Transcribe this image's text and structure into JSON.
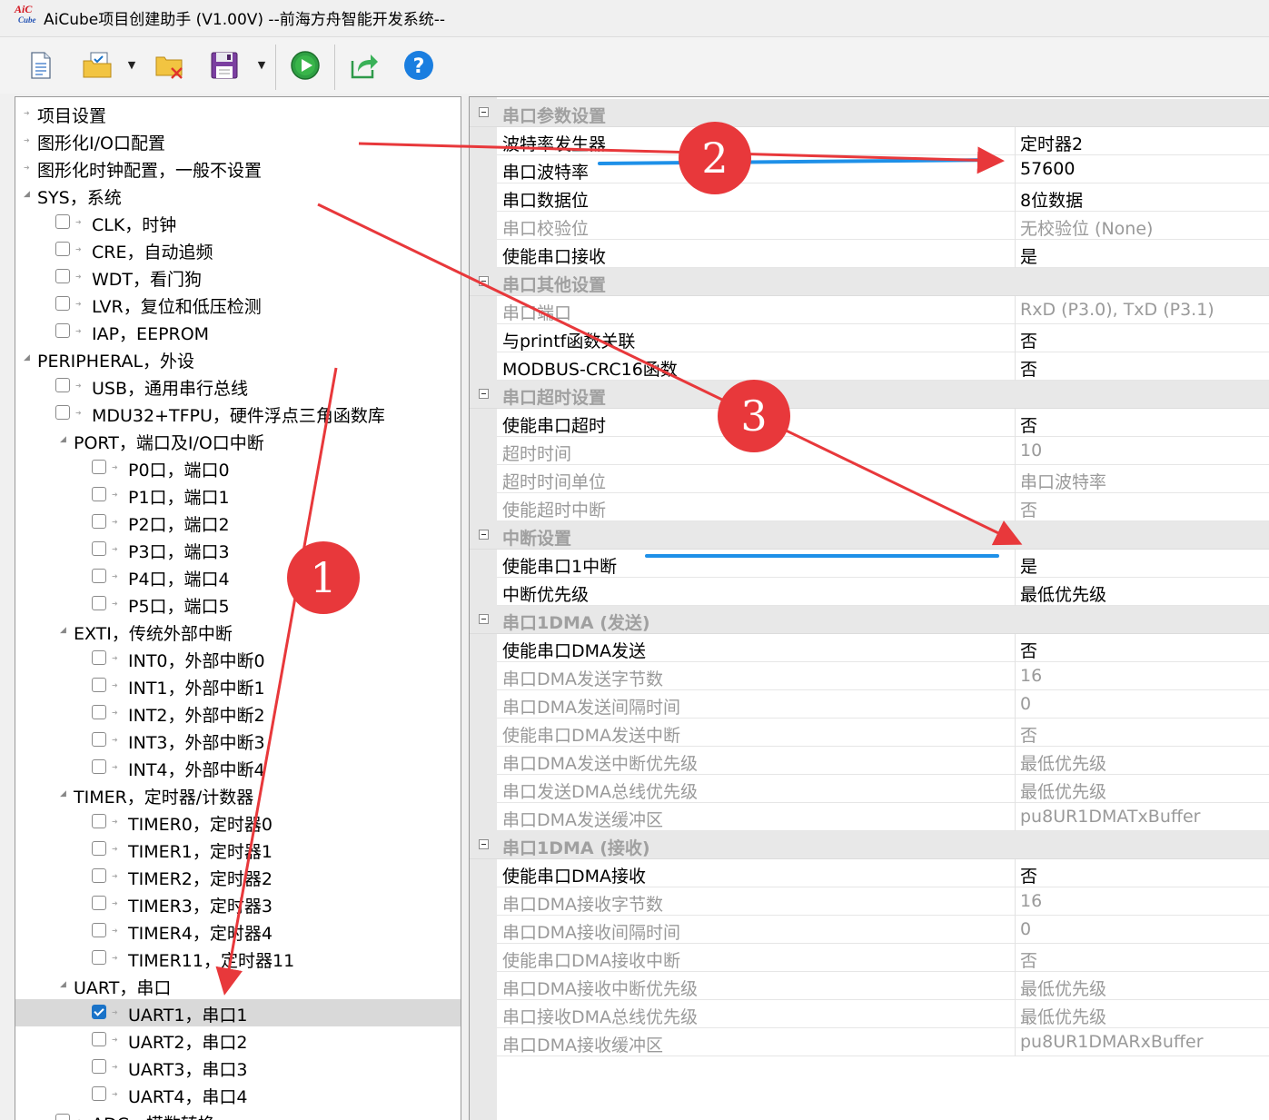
{
  "window": {
    "title": "AiCube项目创建助手 (V1.00V) --前海方舟智能开发系统--",
    "logo_top": "AiC",
    "logo_bottom": "Cube"
  },
  "toolbar": {
    "icons": [
      "new-document-icon",
      "open-folder-icon",
      "close-folder-icon",
      "save-icon",
      "run-icon",
      "export-icon",
      "help-icon"
    ],
    "dropdown_glyph": "▼"
  },
  "tree": {
    "items": [
      {
        "label": "项目设置",
        "level": 0,
        "type": "leaf"
      },
      {
        "label": "图形化I/O口配置",
        "level": 0,
        "type": "leaf"
      },
      {
        "label": "图形化时钟配置，一般不设置",
        "level": 0,
        "type": "leaf"
      },
      {
        "label": "SYS，系统",
        "level": 0,
        "type": "group"
      },
      {
        "label": "CLK，时钟",
        "level": 1,
        "type": "check",
        "checked": false
      },
      {
        "label": "CRE，自动追频",
        "level": 1,
        "type": "check",
        "checked": false
      },
      {
        "label": "WDT，看门狗",
        "level": 1,
        "type": "check",
        "checked": false
      },
      {
        "label": "LVR，复位和低压检测",
        "level": 1,
        "type": "check",
        "checked": false
      },
      {
        "label": "IAP，EEPROM",
        "level": 1,
        "type": "check",
        "checked": false
      },
      {
        "label": "PERIPHERAL，外设",
        "level": 0,
        "type": "group"
      },
      {
        "label": "USB，通用串行总线",
        "level": 1,
        "type": "check",
        "checked": false
      },
      {
        "label": "MDU32+TFPU，硬件浮点三角函数库",
        "level": 1,
        "type": "check",
        "checked": false
      },
      {
        "label": "PORT，端口及I/O口中断",
        "level": 1,
        "type": "group"
      },
      {
        "label": "P0口，端口0",
        "level": 2,
        "type": "check",
        "checked": false
      },
      {
        "label": "P1口，端口1",
        "level": 2,
        "type": "check",
        "checked": false
      },
      {
        "label": "P2口，端口2",
        "level": 2,
        "type": "check",
        "checked": false
      },
      {
        "label": "P3口，端口3",
        "level": 2,
        "type": "check",
        "checked": false
      },
      {
        "label": "P4口，端口4",
        "level": 2,
        "type": "check",
        "checked": false
      },
      {
        "label": "P5口，端口5",
        "level": 2,
        "type": "check",
        "checked": false
      },
      {
        "label": "EXTI，传统外部中断",
        "level": 1,
        "type": "group"
      },
      {
        "label": "INT0，外部中断0",
        "level": 2,
        "type": "check",
        "checked": false
      },
      {
        "label": "INT1，外部中断1",
        "level": 2,
        "type": "check",
        "checked": false
      },
      {
        "label": "INT2，外部中断2",
        "level": 2,
        "type": "check",
        "checked": false
      },
      {
        "label": "INT3，外部中断3",
        "level": 2,
        "type": "check",
        "checked": false
      },
      {
        "label": "INT4，外部中断4",
        "level": 2,
        "type": "check",
        "checked": false
      },
      {
        "label": "TIMER，定时器/计数器",
        "level": 1,
        "type": "group"
      },
      {
        "label": "TIMER0，定时器0",
        "level": 2,
        "type": "check",
        "checked": false
      },
      {
        "label": "TIMER1，定时器1",
        "level": 2,
        "type": "check",
        "checked": false
      },
      {
        "label": "TIMER2，定时器2",
        "level": 2,
        "type": "check",
        "checked": false
      },
      {
        "label": "TIMER3，定时器3",
        "level": 2,
        "type": "check",
        "checked": false
      },
      {
        "label": "TIMER4，定时器4",
        "level": 2,
        "type": "check",
        "checked": false
      },
      {
        "label": "TIMER11，定时器11",
        "level": 2,
        "type": "check",
        "checked": false
      },
      {
        "label": "UART，串口",
        "level": 1,
        "type": "group"
      },
      {
        "label": "UART1，串口1",
        "level": 2,
        "type": "check",
        "checked": true,
        "selected": true
      },
      {
        "label": "UART2，串口2",
        "level": 2,
        "type": "check",
        "checked": false
      },
      {
        "label": "UART3，串口3",
        "level": 2,
        "type": "check",
        "checked": false
      },
      {
        "label": "UART4，串口4",
        "level": 2,
        "type": "check",
        "checked": false
      },
      {
        "label": "ADC，模数转换",
        "level": 1,
        "type": "check",
        "checked": false
      }
    ]
  },
  "properties": {
    "rows": [
      {
        "type": "category",
        "label": "串口参数设置"
      },
      {
        "name": "波特率发生器",
        "value": "定时器2",
        "enabled": true
      },
      {
        "name": "串口波特率",
        "value": "57600",
        "enabled": true
      },
      {
        "name": "串口数据位",
        "value": "8位数据",
        "enabled": true
      },
      {
        "name": "串口校验位",
        "value": "无校验位 (None)",
        "enabled": false
      },
      {
        "name": "使能串口接收",
        "value": "是",
        "enabled": true
      },
      {
        "type": "category",
        "label": "串口其他设置"
      },
      {
        "name": "串口端口",
        "value": "RxD (P3.0), TxD (P3.1)",
        "enabled": false
      },
      {
        "name": "与printf函数关联",
        "value": "否",
        "enabled": true
      },
      {
        "name": "MODBUS-CRC16函数",
        "value": "否",
        "enabled": true
      },
      {
        "type": "category",
        "label": "串口超时设置"
      },
      {
        "name": "使能串口超时",
        "value": "否",
        "enabled": true
      },
      {
        "name": "超时时间",
        "value": "10",
        "enabled": false
      },
      {
        "name": "超时时间单位",
        "value": "串口波特率",
        "enabled": false
      },
      {
        "name": "使能超时中断",
        "value": "否",
        "enabled": false
      },
      {
        "type": "category",
        "label": "中断设置"
      },
      {
        "name": "使能串口1中断",
        "value": "是",
        "enabled": true
      },
      {
        "name": "中断优先级",
        "value": "最低优先级",
        "enabled": true
      },
      {
        "type": "category",
        "label": "串口1DMA (发送)"
      },
      {
        "name": "使能串口DMA发送",
        "value": "否",
        "enabled": true
      },
      {
        "name": "串口DMA发送字节数",
        "value": "16",
        "enabled": false
      },
      {
        "name": "串口DMA发送间隔时间",
        "value": "0",
        "enabled": false
      },
      {
        "name": "使能串口DMA发送中断",
        "value": "否",
        "enabled": false
      },
      {
        "name": "串口DMA发送中断优先级",
        "value": "最低优先级",
        "enabled": false
      },
      {
        "name": "串口发送DMA总线优先级",
        "value": "最低优先级",
        "enabled": false
      },
      {
        "name": "串口DMA发送缓冲区",
        "value": "pu8UR1DMATxBuffer",
        "enabled": false
      },
      {
        "type": "category",
        "label": "串口1DMA (接收)"
      },
      {
        "name": "使能串口DMA接收",
        "value": "否",
        "enabled": true
      },
      {
        "name": "串口DMA接收字节数",
        "value": "16",
        "enabled": false
      },
      {
        "name": "串口DMA接收间隔时间",
        "value": "0",
        "enabled": false
      },
      {
        "name": "使能串口DMA接收中断",
        "value": "否",
        "enabled": false
      },
      {
        "name": "串口DMA接收中断优先级",
        "value": "最低优先级",
        "enabled": false
      },
      {
        "name": "串口接收DMA总线优先级",
        "value": "最低优先级",
        "enabled": false
      },
      {
        "name": "串口DMA接收缓冲区",
        "value": "pu8UR1DMARxBuffer",
        "enabled": false
      }
    ]
  },
  "annotations": {
    "badges": [
      "1",
      "2",
      "3"
    ],
    "arrow_color": "#e8383b",
    "underline_color": "#1e90e8"
  },
  "colors": {
    "checkbox_checked": "#1a73c8",
    "selected_row": "#d9d9d9",
    "category_bg": "#e8e8e8"
  }
}
